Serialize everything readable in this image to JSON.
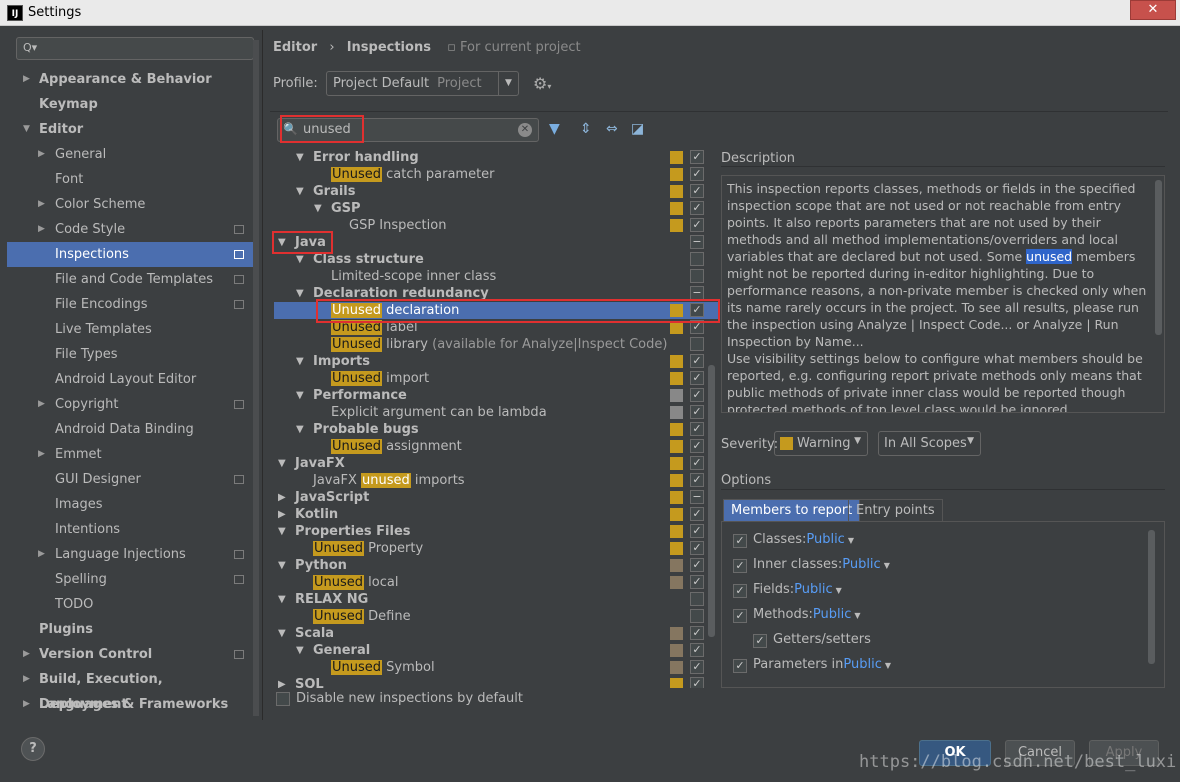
{
  "window": {
    "title": "Settings",
    "app_icon": "IJ",
    "close": "✕"
  },
  "sidebar": {
    "search_placeholder": "Q▾",
    "items": [
      {
        "label": "Appearance & Behavior"
      },
      {
        "label": "Keymap"
      },
      {
        "label": "Editor"
      },
      {
        "label": "General"
      },
      {
        "label": "Font"
      },
      {
        "label": "Color Scheme"
      },
      {
        "label": "Code Style"
      },
      {
        "label": "Inspections"
      },
      {
        "label": "File and Code Templates"
      },
      {
        "label": "File Encodings"
      },
      {
        "label": "Live Templates"
      },
      {
        "label": "File Types"
      },
      {
        "label": "Android Layout Editor"
      },
      {
        "label": "Copyright"
      },
      {
        "label": "Android Data Binding"
      },
      {
        "label": "Emmet"
      },
      {
        "label": "GUI Designer"
      },
      {
        "label": "Images"
      },
      {
        "label": "Intentions"
      },
      {
        "label": "Language Injections"
      },
      {
        "label": "Spelling"
      },
      {
        "label": "TODO"
      },
      {
        "label": "Plugins"
      },
      {
        "label": "Version Control"
      },
      {
        "label": "Build, Execution, Deployment"
      },
      {
        "label": "Languages & Frameworks"
      }
    ],
    "help": "?"
  },
  "header": {
    "crumb1": "Editor",
    "crumb_sep": "›",
    "crumb2": "Inspections",
    "for_project": "For current project",
    "profile_label": "Profile:",
    "profile_value": "Project Default",
    "profile_scope": "Project"
  },
  "filter": {
    "value": "unused"
  },
  "tree": [
    {
      "text": "Error handling"
    },
    {
      "hl": "Unused",
      "text": " catch parameter"
    },
    {
      "text": "Grails"
    },
    {
      "text": "GSP"
    },
    {
      "text": "GSP Inspection"
    },
    {
      "text": "Java"
    },
    {
      "text": "Class structure"
    },
    {
      "text": "Limited-scope inner class"
    },
    {
      "text": "Declaration redundancy"
    },
    {
      "hl": "Unused",
      "text": " declaration"
    },
    {
      "hl": "Unused",
      "text": " label"
    },
    {
      "hl": "Unused",
      "text": " library",
      "hint": " (available for Analyze|Inspect Code)"
    },
    {
      "text": "Imports"
    },
    {
      "hl": "Unused",
      "text": " import"
    },
    {
      "text": "Performance"
    },
    {
      "text": "Explicit argument can be lambda"
    },
    {
      "text": "Probable bugs"
    },
    {
      "hl": "Unused",
      "text": " assignment"
    },
    {
      "text": "JavaFX"
    },
    {
      "pre": "JavaFX ",
      "hl": "unused",
      "text": " imports"
    },
    {
      "text": "JavaScript"
    },
    {
      "text": "Kotlin"
    },
    {
      "text": "Properties Files"
    },
    {
      "hl": "Unused",
      "text": " Property"
    },
    {
      "text": "Python"
    },
    {
      "hl": "Unused",
      "text": " local"
    },
    {
      "text": "RELAX NG"
    },
    {
      "hl": "Unused",
      "text": " Define"
    },
    {
      "text": "Scala"
    },
    {
      "text": "General"
    },
    {
      "hl": "Unused",
      "text": " Symbol"
    },
    {
      "text": "SQL"
    }
  ],
  "disable_new": "Disable new inspections by default",
  "description": {
    "label": "Description",
    "p1_a": "This inspection reports classes, methods or fields in the specified inspection scope that are not used or not reachable from entry points. It also reports parameters that are not used by their methods and all method implementations/overriders and local variables that are declared but not used. Some ",
    "p1_hl": "unused",
    "p1_b": " members might not be reported during in-editor highlighting. Due to performance reasons, a non-private member is checked only when its name rarely occurs in the project. To see all results, please run the inspection using Analyze | Inspect Code... or Analyze | Run Inspection by Name...",
    "p2": "Use visibility settings below to configure what members should be reported, e.g. configuring report private methods only means that public methods of private inner class would be reported though protected methods of top level class would be ignored."
  },
  "severity": {
    "label": "Severity:",
    "value": "Warning",
    "scope": "In All Scopes",
    "color": "#c59a1e"
  },
  "options": {
    "label": "Options",
    "tab_members": "Members to report",
    "tab_entry": "Entry points",
    "classes": "Classes:",
    "inner": "Inner classes:",
    "fields": "Fields:",
    "methods": "Methods:",
    "getters": "Getters/setters",
    "params": "Parameters in",
    "public": "Public"
  },
  "buttons": {
    "ok": "OK",
    "cancel": "Cancel",
    "apply": "Apply"
  },
  "watermark": "https://blog.csdn.net/best_luxi",
  "colors": {
    "selection": "#4b6eaf",
    "warning": "#c59a1e",
    "highlight_red": "#e03030"
  }
}
